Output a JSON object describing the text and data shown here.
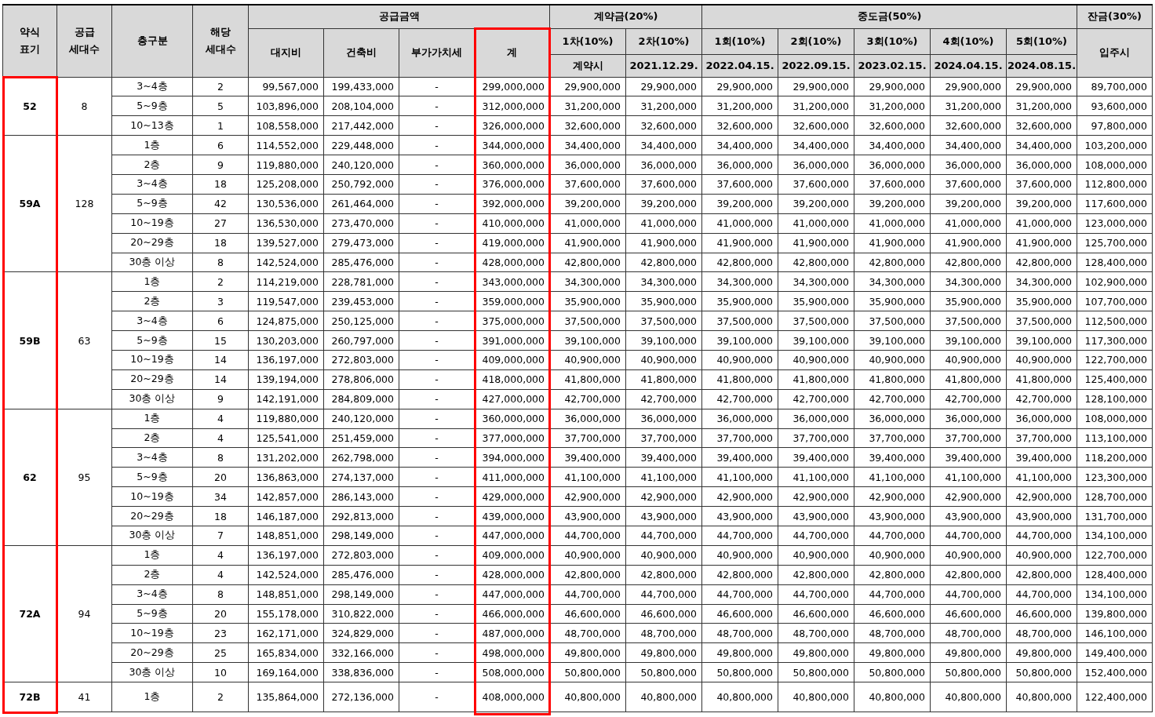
{
  "table": {
    "header": {
      "type_label": "약식\n표기",
      "households_label": "공급\n세대수",
      "floor_label": "층구분",
      "units_label": "해당\n세대수",
      "supply_group": "공급금액",
      "supply_columns": [
        {
          "label": "대지비",
          "highlighted": false
        },
        {
          "label": "건축비",
          "highlighted": false
        },
        {
          "label": "부가가치세",
          "highlighted": false
        },
        {
          "label": "계",
          "highlighted": true
        }
      ],
      "deposit_group": "계약금(20%)",
      "deposit_columns": [
        {
          "label": "1차(10%)",
          "date": "계약시"
        },
        {
          "label": "2차(10%)",
          "date": "2021.12.29."
        }
      ],
      "interim_group": "중도금(50%)",
      "interim_columns": [
        {
          "label": "1회(10%)",
          "date": "2022.04.15."
        },
        {
          "label": "2회(10%)",
          "date": "2022.09.15."
        },
        {
          "label": "3회(10%)",
          "date": "2023.02.15."
        },
        {
          "label": "4회(10%)",
          "date": "2024.04.15."
        },
        {
          "label": "5회(10%)",
          "date": "2024.08.15."
        }
      ],
      "balance_group": "잔금(30%)",
      "balance_date": "입주시"
    },
    "type_column_highlighted": true,
    "groups": [
      {
        "type": "52",
        "households": "8",
        "rows": [
          {
            "floor": "3~4층",
            "units": "2",
            "land": "99,567,000",
            "building": "199,433,000",
            "vat": "-",
            "total": "299,000,000",
            "installments": [
              "29,900,000",
              "29,900,000",
              "29,900,000",
              "29,900,000",
              "29,900,000",
              "29,900,000",
              "29,900,000"
            ],
            "balance": "89,700,000"
          },
          {
            "floor": "5~9층",
            "units": "5",
            "land": "103,896,000",
            "building": "208,104,000",
            "vat": "-",
            "total": "312,000,000",
            "installments": [
              "31,200,000",
              "31,200,000",
              "31,200,000",
              "31,200,000",
              "31,200,000",
              "31,200,000",
              "31,200,000"
            ],
            "balance": "93,600,000"
          },
          {
            "floor": "10~13층",
            "units": "1",
            "land": "108,558,000",
            "building": "217,442,000",
            "vat": "-",
            "total": "326,000,000",
            "installments": [
              "32,600,000",
              "32,600,000",
              "32,600,000",
              "32,600,000",
              "32,600,000",
              "32,600,000",
              "32,600,000"
            ],
            "balance": "97,800,000"
          }
        ]
      },
      {
        "type": "59A",
        "households": "128",
        "rows": [
          {
            "floor": "1층",
            "units": "6",
            "land": "114,552,000",
            "building": "229,448,000",
            "vat": "-",
            "total": "344,000,000",
            "installments": [
              "34,400,000",
              "34,400,000",
              "34,400,000",
              "34,400,000",
              "34,400,000",
              "34,400,000",
              "34,400,000"
            ],
            "balance": "103,200,000"
          },
          {
            "floor": "2층",
            "units": "9",
            "land": "119,880,000",
            "building": "240,120,000",
            "vat": "-",
            "total": "360,000,000",
            "installments": [
              "36,000,000",
              "36,000,000",
              "36,000,000",
              "36,000,000",
              "36,000,000",
              "36,000,000",
              "36,000,000"
            ],
            "balance": "108,000,000"
          },
          {
            "floor": "3~4층",
            "units": "18",
            "land": "125,208,000",
            "building": "250,792,000",
            "vat": "-",
            "total": "376,000,000",
            "installments": [
              "37,600,000",
              "37,600,000",
              "37,600,000",
              "37,600,000",
              "37,600,000",
              "37,600,000",
              "37,600,000"
            ],
            "balance": "112,800,000"
          },
          {
            "floor": "5~9층",
            "units": "42",
            "land": "130,536,000",
            "building": "261,464,000",
            "vat": "-",
            "total": "392,000,000",
            "installments": [
              "39,200,000",
              "39,200,000",
              "39,200,000",
              "39,200,000",
              "39,200,000",
              "39,200,000",
              "39,200,000"
            ],
            "balance": "117,600,000"
          },
          {
            "floor": "10~19층",
            "units": "27",
            "land": "136,530,000",
            "building": "273,470,000",
            "vat": "-",
            "total": "410,000,000",
            "installments": [
              "41,000,000",
              "41,000,000",
              "41,000,000",
              "41,000,000",
              "41,000,000",
              "41,000,000",
              "41,000,000"
            ],
            "balance": "123,000,000"
          },
          {
            "floor": "20~29층",
            "units": "18",
            "land": "139,527,000",
            "building": "279,473,000",
            "vat": "-",
            "total": "419,000,000",
            "installments": [
              "41,900,000",
              "41,900,000",
              "41,900,000",
              "41,900,000",
              "41,900,000",
              "41,900,000",
              "41,900,000"
            ],
            "balance": "125,700,000"
          },
          {
            "floor": "30층 이상",
            "units": "8",
            "land": "142,524,000",
            "building": "285,476,000",
            "vat": "-",
            "total": "428,000,000",
            "installments": [
              "42,800,000",
              "42,800,000",
              "42,800,000",
              "42,800,000",
              "42,800,000",
              "42,800,000",
              "42,800,000"
            ],
            "balance": "128,400,000"
          }
        ]
      },
      {
        "type": "59B",
        "households": "63",
        "rows": [
          {
            "floor": "1층",
            "units": "2",
            "land": "114,219,000",
            "building": "228,781,000",
            "vat": "-",
            "total": "343,000,000",
            "installments": [
              "34,300,000",
              "34,300,000",
              "34,300,000",
              "34,300,000",
              "34,300,000",
              "34,300,000",
              "34,300,000"
            ],
            "balance": "102,900,000"
          },
          {
            "floor": "2층",
            "units": "3",
            "land": "119,547,000",
            "building": "239,453,000",
            "vat": "-",
            "total": "359,000,000",
            "installments": [
              "35,900,000",
              "35,900,000",
              "35,900,000",
              "35,900,000",
              "35,900,000",
              "35,900,000",
              "35,900,000"
            ],
            "balance": "107,700,000"
          },
          {
            "floor": "3~4층",
            "units": "6",
            "land": "124,875,000",
            "building": "250,125,000",
            "vat": "-",
            "total": "375,000,000",
            "installments": [
              "37,500,000",
              "37,500,000",
              "37,500,000",
              "37,500,000",
              "37,500,000",
              "37,500,000",
              "37,500,000"
            ],
            "balance": "112,500,000"
          },
          {
            "floor": "5~9층",
            "units": "15",
            "land": "130,203,000",
            "building": "260,797,000",
            "vat": "-",
            "total": "391,000,000",
            "installments": [
              "39,100,000",
              "39,100,000",
              "39,100,000",
              "39,100,000",
              "39,100,000",
              "39,100,000",
              "39,100,000"
            ],
            "balance": "117,300,000"
          },
          {
            "floor": "10~19층",
            "units": "14",
            "land": "136,197,000",
            "building": "272,803,000",
            "vat": "-",
            "total": "409,000,000",
            "installments": [
              "40,900,000",
              "40,900,000",
              "40,900,000",
              "40,900,000",
              "40,900,000",
              "40,900,000",
              "40,900,000"
            ],
            "balance": "122,700,000"
          },
          {
            "floor": "20~29층",
            "units": "14",
            "land": "139,194,000",
            "building": "278,806,000",
            "vat": "-",
            "total": "418,000,000",
            "installments": [
              "41,800,000",
              "41,800,000",
              "41,800,000",
              "41,800,000",
              "41,800,000",
              "41,800,000",
              "41,800,000"
            ],
            "balance": "125,400,000"
          },
          {
            "floor": "30층 이상",
            "units": "9",
            "land": "142,191,000",
            "building": "284,809,000",
            "vat": "-",
            "total": "427,000,000",
            "installments": [
              "42,700,000",
              "42,700,000",
              "42,700,000",
              "42,700,000",
              "42,700,000",
              "42,700,000",
              "42,700,000"
            ],
            "balance": "128,100,000"
          }
        ]
      },
      {
        "type": "62",
        "households": "95",
        "rows": [
          {
            "floor": "1층",
            "units": "4",
            "land": "119,880,000",
            "building": "240,120,000",
            "vat": "-",
            "total": "360,000,000",
            "installments": [
              "36,000,000",
              "36,000,000",
              "36,000,000",
              "36,000,000",
              "36,000,000",
              "36,000,000",
              "36,000,000"
            ],
            "balance": "108,000,000"
          },
          {
            "floor": "2층",
            "units": "4",
            "land": "125,541,000",
            "building": "251,459,000",
            "vat": "-",
            "total": "377,000,000",
            "installments": [
              "37,700,000",
              "37,700,000",
              "37,700,000",
              "37,700,000",
              "37,700,000",
              "37,700,000",
              "37,700,000"
            ],
            "balance": "113,100,000"
          },
          {
            "floor": "3~4층",
            "units": "8",
            "land": "131,202,000",
            "building": "262,798,000",
            "vat": "-",
            "total": "394,000,000",
            "installments": [
              "39,400,000",
              "39,400,000",
              "39,400,000",
              "39,400,000",
              "39,400,000",
              "39,400,000",
              "39,400,000"
            ],
            "balance": "118,200,000"
          },
          {
            "floor": "5~9층",
            "units": "20",
            "land": "136,863,000",
            "building": "274,137,000",
            "vat": "-",
            "total": "411,000,000",
            "installments": [
              "41,100,000",
              "41,100,000",
              "41,100,000",
              "41,100,000",
              "41,100,000",
              "41,100,000",
              "41,100,000"
            ],
            "balance": "123,300,000"
          },
          {
            "floor": "10~19층",
            "units": "34",
            "land": "142,857,000",
            "building": "286,143,000",
            "vat": "-",
            "total": "429,000,000",
            "installments": [
              "42,900,000",
              "42,900,000",
              "42,900,000",
              "42,900,000",
              "42,900,000",
              "42,900,000",
              "42,900,000"
            ],
            "balance": "128,700,000"
          },
          {
            "floor": "20~29층",
            "units": "18",
            "land": "146,187,000",
            "building": "292,813,000",
            "vat": "-",
            "total": "439,000,000",
            "installments": [
              "43,900,000",
              "43,900,000",
              "43,900,000",
              "43,900,000",
              "43,900,000",
              "43,900,000",
              "43,900,000"
            ],
            "balance": "131,700,000"
          },
          {
            "floor": "30층 이상",
            "units": "7",
            "land": "148,851,000",
            "building": "298,149,000",
            "vat": "-",
            "total": "447,000,000",
            "installments": [
              "44,700,000",
              "44,700,000",
              "44,700,000",
              "44,700,000",
              "44,700,000",
              "44,700,000",
              "44,700,000"
            ],
            "balance": "134,100,000"
          }
        ]
      },
      {
        "type": "72A",
        "households": "94",
        "rows": [
          {
            "floor": "1층",
            "units": "4",
            "land": "136,197,000",
            "building": "272,803,000",
            "vat": "-",
            "total": "409,000,000",
            "installments": [
              "40,900,000",
              "40,900,000",
              "40,900,000",
              "40,900,000",
              "40,900,000",
              "40,900,000",
              "40,900,000"
            ],
            "balance": "122,700,000"
          },
          {
            "floor": "2층",
            "units": "4",
            "land": "142,524,000",
            "building": "285,476,000",
            "vat": "-",
            "total": "428,000,000",
            "installments": [
              "42,800,000",
              "42,800,000",
              "42,800,000",
              "42,800,000",
              "42,800,000",
              "42,800,000",
              "42,800,000"
            ],
            "balance": "128,400,000"
          },
          {
            "floor": "3~4층",
            "units": "8",
            "land": "148,851,000",
            "building": "298,149,000",
            "vat": "-",
            "total": "447,000,000",
            "installments": [
              "44,700,000",
              "44,700,000",
              "44,700,000",
              "44,700,000",
              "44,700,000",
              "44,700,000",
              "44,700,000"
            ],
            "balance": "134,100,000"
          },
          {
            "floor": "5~9층",
            "units": "20",
            "land": "155,178,000",
            "building": "310,822,000",
            "vat": "-",
            "total": "466,000,000",
            "installments": [
              "46,600,000",
              "46,600,000",
              "46,600,000",
              "46,600,000",
              "46,600,000",
              "46,600,000",
              "46,600,000"
            ],
            "balance": "139,800,000"
          },
          {
            "floor": "10~19층",
            "units": "23",
            "land": "162,171,000",
            "building": "324,829,000",
            "vat": "-",
            "total": "487,000,000",
            "installments": [
              "48,700,000",
              "48,700,000",
              "48,700,000",
              "48,700,000",
              "48,700,000",
              "48,700,000",
              "48,700,000"
            ],
            "balance": "146,100,000"
          },
          {
            "floor": "20~29층",
            "units": "25",
            "land": "165,834,000",
            "building": "332,166,000",
            "vat": "-",
            "total": "498,000,000",
            "installments": [
              "49,800,000",
              "49,800,000",
              "49,800,000",
              "49,800,000",
              "49,800,000",
              "49,800,000",
              "49,800,000"
            ],
            "balance": "149,400,000"
          },
          {
            "floor": "30층 이상",
            "units": "10",
            "land": "169,164,000",
            "building": "338,836,000",
            "vat": "-",
            "total": "508,000,000",
            "installments": [
              "50,800,000",
              "50,800,000",
              "50,800,000",
              "50,800,000",
              "50,800,000",
              "50,800,000",
              "50,800,000"
            ],
            "balance": "152,400,000"
          }
        ]
      },
      {
        "type": "72B",
        "households": "41",
        "rows": [
          {
            "floor": "1층",
            "units": "2",
            "land": "135,864,000",
            "building": "272,136,000",
            "vat": "-",
            "total": "408,000,000",
            "installments": [
              "40,800,000",
              "40,800,000",
              "40,800,000",
              "40,800,000",
              "40,800,000",
              "40,800,000",
              "40,800,000"
            ],
            "balance": "122,400,000"
          }
        ]
      }
    ]
  }
}
